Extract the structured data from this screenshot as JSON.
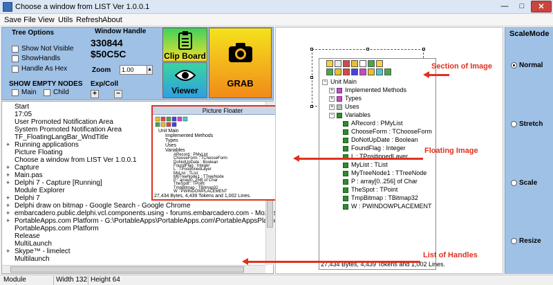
{
  "window": {
    "title": "Choose a window from  LIST   Ver 1.0.0.1",
    "min_glyph": "—",
    "max_glyph": "□",
    "close_glyph": "✕"
  },
  "menu": [
    "Save File",
    "View",
    "Utils",
    "Refresh",
    "About"
  ],
  "options": {
    "title": "Tree Options",
    "show_not_visible": "Show Not Visible",
    "show_handls": "ShowHandls",
    "handle_as_hex": "Handle As Hex",
    "window_handle_label": "Window Handle",
    "handle_dec": "330844",
    "handle_hex": "$50C5C",
    "zoom_label": "Zoom",
    "zoom_value": "1.00",
    "show_empty_nodes": "SHOW EMPTY NODES",
    "main": "Main",
    "child": "Child",
    "exp_coll": "Exp/Coll",
    "plus": "+",
    "minus": "−"
  },
  "buttons": {
    "clipboard": "Clip Board",
    "viewer": "Viewer",
    "grab": "GRAB"
  },
  "list_items": [
    "Start",
    "17:05",
    "User Promoted Notification Area",
    "System Promoted Notification Area",
    "TF_FloatingLangBar_WndTitle",
    "Running applications",
    "Picture Floating",
    "Choose a window from  LIST   Ver 1.0.0.1",
    "Capture",
    "Main.pas",
    "Delphi 7 - Capture [Running]",
    "Module Explorer",
    "Delphi 7",
    "Delphi draw on bitmap - Google Search - Google Chrome",
    "embarcadero.public.delphi.vcl.components.using - forums.embarcadero.com - Mozilla",
    "PortableApps.com Platform - G:\\PortableApps\\PortableApps.com\\PortableAppsPlatfo",
    "PortableApps.com Platform",
    "Release",
    "MultiLaunch",
    "Skype™ - limelect",
    "Multilaunch"
  ],
  "list_expanders": [
    {
      "row": 5,
      "glyph": "+"
    },
    {
      "row": 8,
      "glyph": "+"
    },
    {
      "row": 9,
      "glyph": "+"
    },
    {
      "row": 10,
      "glyph": "+"
    },
    {
      "row": 12,
      "glyph": "+"
    },
    {
      "row": 13,
      "glyph": "+"
    },
    {
      "row": 14,
      "glyph": "+"
    },
    {
      "row": 15,
      "glyph": "+"
    },
    {
      "row": 19,
      "glyph": "+"
    }
  ],
  "status": {
    "module": "Module Explorer",
    "width": "Width  132",
    "height": "Height   64"
  },
  "floater": {
    "title": "Picture Floater",
    "status": "27,434 Bytes, 4,439 Tokens and 1,002 Lines."
  },
  "tree": {
    "unit": "Unit Main",
    "implemented": "Implemented Methods",
    "types": "Types",
    "uses": "Uses",
    "variables": "Variables",
    "vars": [
      "ARecord : PMyList",
      "ChooseForm : TChooseForm",
      "DoNotUpDate : Boolean",
      "FoundFlag : Integer",
      "L : TPositionedLayer",
      "MyList : TList",
      "MyTreeNode1 : TTreeNode",
      "P : array[0..256] of Char",
      "TheSpot : TPoint",
      "TmpBitmap : TBitmap32",
      "W : PWINDOWPLACEMENT"
    ],
    "status": "27,434 Bytes, 4,439 Tokens and 1,002 Lines."
  },
  "scale": {
    "title": "ScaleMode",
    "normal": "Normal",
    "stretch": "Stretch",
    "scale": "Scale",
    "resize": "Resize",
    "selected": "Normal"
  },
  "annotations": {
    "section": "Section of Image",
    "floating": "Floating Image",
    "handles": "List of Handles"
  },
  "colors": {
    "accent": "#e0301e",
    "panel": "#9fc1e6"
  }
}
